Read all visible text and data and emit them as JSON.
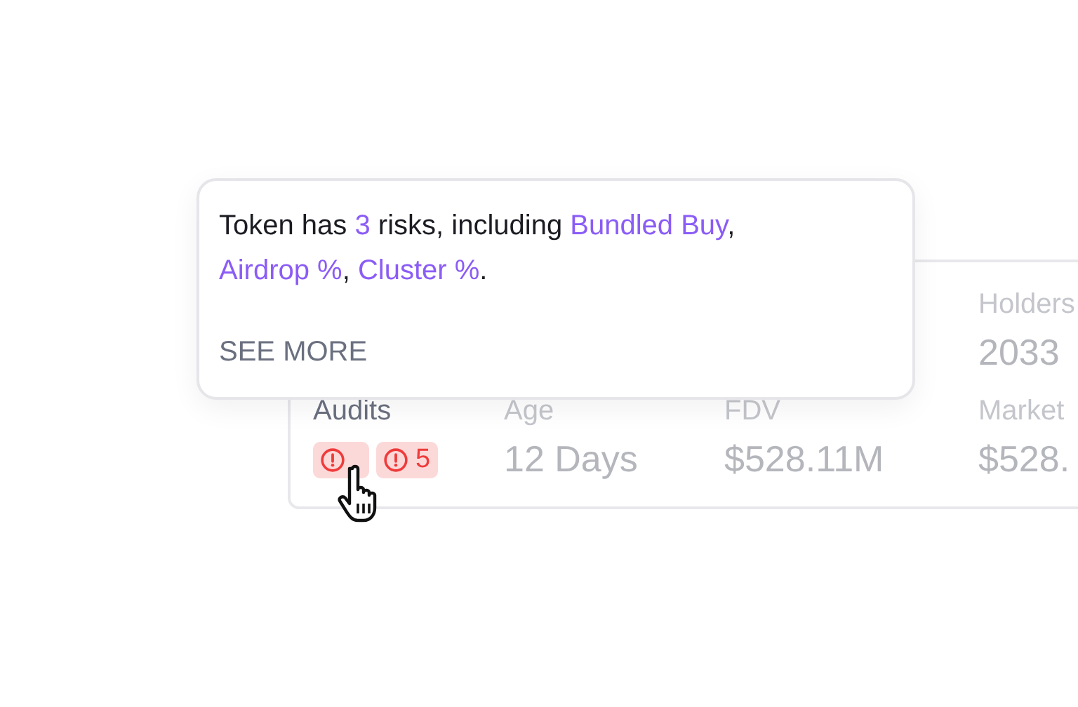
{
  "tooltip": {
    "segments": [
      {
        "text": "Token has ",
        "highlight": false
      },
      {
        "text": "3",
        "highlight": true
      },
      {
        "text": " risks, including ",
        "highlight": false
      },
      {
        "text": "Bundled Buy",
        "highlight": true
      },
      {
        "text": ", ",
        "highlight": false
      },
      {
        "text": "Airdrop %",
        "highlight": true
      },
      {
        "text": ", ",
        "highlight": false
      },
      {
        "text": "Cluster %",
        "highlight": true
      },
      {
        "text": ".",
        "highlight": false
      }
    ],
    "link": "SEE MORE"
  },
  "stats_top": [
    {
      "label": "Holders",
      "value": "2033"
    }
  ],
  "stats_bottom": [
    {
      "kind": "audits",
      "label": "Audits",
      "badges": [
        {
          "kind": "icon"
        },
        {
          "kind": "count",
          "count": "5"
        }
      ]
    },
    {
      "kind": "text",
      "label": "Age",
      "value": "12 Days"
    },
    {
      "kind": "text",
      "label": "FDV",
      "value": "$528.11M"
    },
    {
      "kind": "text",
      "label": "Market",
      "value": "$528."
    }
  ]
}
